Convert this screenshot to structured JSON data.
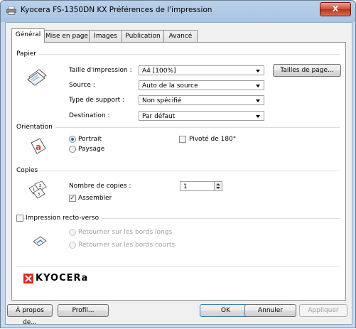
{
  "window": {
    "title": "Kyocera FS-1350DN KX Préférences de l'impression",
    "close_label": "X"
  },
  "tabs": [
    {
      "label": "Général"
    },
    {
      "label": "Mise en page"
    },
    {
      "label": "Images"
    },
    {
      "label": "Publication"
    },
    {
      "label": "Avancé"
    }
  ],
  "paper": {
    "section": "Papier",
    "size_label": "Taille d'impression :",
    "size_value": "A4  [100%]",
    "source_label": "Source :",
    "source_value": "Auto de la source",
    "media_label": "Type de support :",
    "media_value": "Non spécifié",
    "dest_label": "Destination :",
    "dest_value": "Par défaut",
    "sizes_button": "Tailles de page..."
  },
  "orientation": {
    "section": "Orientation",
    "portrait": "Portrait",
    "landscape": "Paysage",
    "rotate": "Pivoté de 180°"
  },
  "copies": {
    "section": "Copies",
    "count_label": "Nombre de copies :",
    "count_value": "1",
    "collate": "Assembler"
  },
  "duplex": {
    "section": "Impression recto-verso",
    "long_edge": "Retourner sur les bords longs",
    "short_edge": "Retourner sur les bords courts"
  },
  "logo": {
    "text": "KYOCERa"
  },
  "footer": {
    "about": "À propos de...",
    "profile": "Profil...",
    "ok": "OK",
    "cancel": "Annuler",
    "apply": "Appliquer"
  }
}
